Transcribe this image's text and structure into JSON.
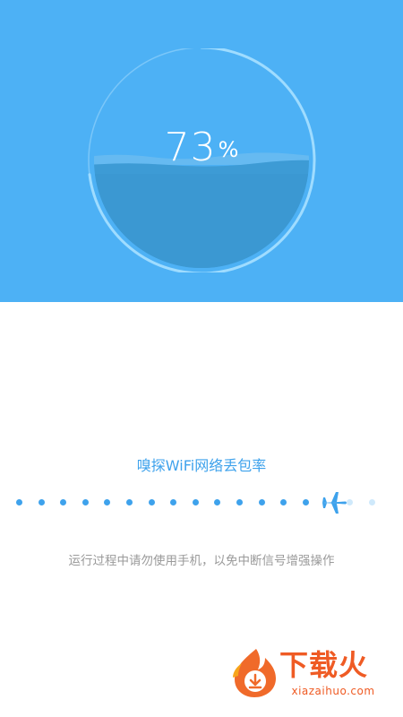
{
  "gauge": {
    "percent_value": "73",
    "percent_unit": "%",
    "fill_fraction": 0.73
  },
  "task": {
    "title": "嗅探WiFi网络丢包率",
    "progress": {
      "completed_steps": 14,
      "total_steps": 17,
      "current_icon": "airplane-icon"
    }
  },
  "notice": {
    "text": "运行过程中请勿使用手机，以免中断信号增强操作"
  },
  "watermark": {
    "brand": "下载火",
    "site": "xiazaihuo.com",
    "icon": "flame-download-icon"
  },
  "colors": {
    "hero_background": "#4db1f5",
    "water": "#3d9bd5",
    "accent": "#3ea2ec",
    "muted_text": "#9a9a9a",
    "watermark": "#ef5b24"
  }
}
